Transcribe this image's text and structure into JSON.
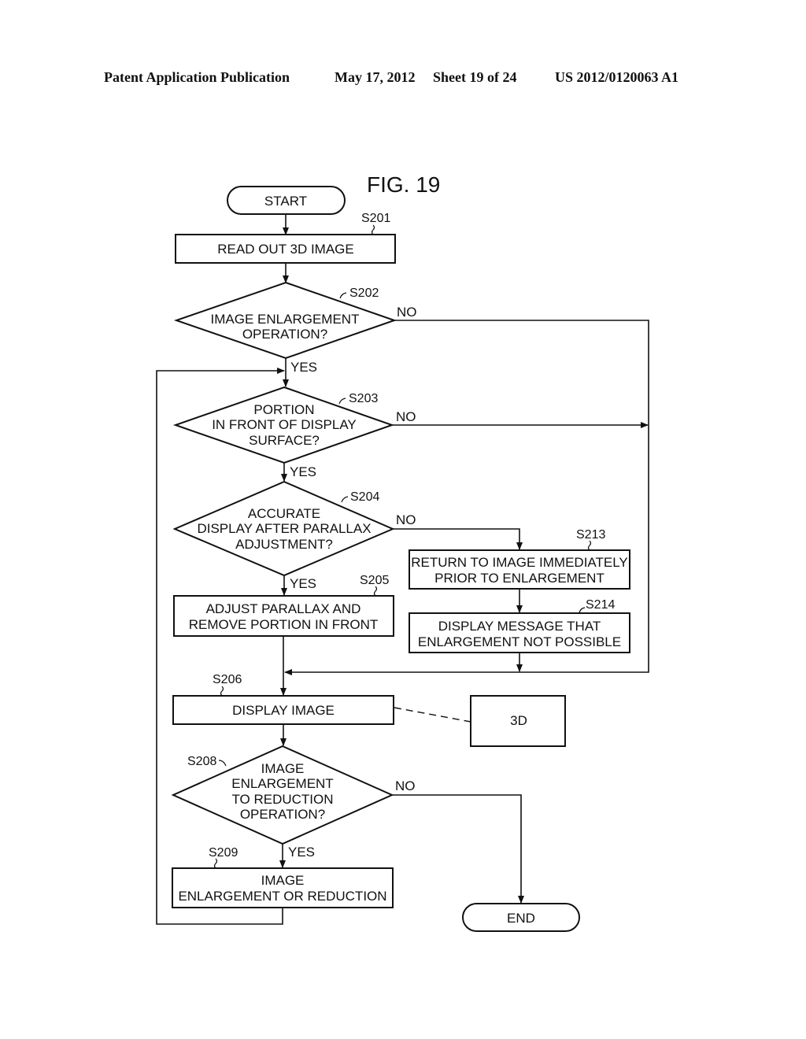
{
  "header": {
    "left": "Patent Application Publication",
    "date": "May 17, 2012",
    "sheet": "Sheet 19 of 24",
    "number": "US 2012/0120063 A1"
  },
  "figure": {
    "title": "FIG. 19",
    "terminals": {
      "start": "START",
      "end": "END"
    },
    "steps": {
      "s201": {
        "id": "S201",
        "lines": [
          "READ OUT 3D IMAGE"
        ]
      },
      "s202": {
        "id": "S202",
        "lines": [
          "IMAGE ENLARGEMENT",
          "OPERATION?"
        ]
      },
      "s203": {
        "id": "S203",
        "lines": [
          "PORTION",
          "IN FRONT OF DISPLAY",
          "SURFACE?"
        ]
      },
      "s204": {
        "id": "S204",
        "lines": [
          "ACCURATE",
          "DISPLAY AFTER PARALLAX",
          "ADJUSTMENT?"
        ]
      },
      "s205": {
        "id": "S205",
        "lines": [
          "ADJUST PARALLAX AND",
          "REMOVE PORTION IN FRONT"
        ]
      },
      "s206": {
        "id": "S206",
        "lines": [
          "DISPLAY IMAGE"
        ]
      },
      "s208": {
        "id": "S208",
        "lines": [
          "IMAGE",
          "ENLARGEMENT",
          "TO REDUCTION",
          "OPERATION?"
        ]
      },
      "s209": {
        "id": "S209",
        "lines": [
          "IMAGE",
          "ENLARGEMENT OR REDUCTION"
        ]
      },
      "s213": {
        "id": "S213",
        "lines": [
          "RETURN TO IMAGE IMMEDIATELY",
          "PRIOR TO ENLARGEMENT"
        ]
      },
      "s214": {
        "id": "S214",
        "lines": [
          "DISPLAY MESSAGE THAT",
          "ENLARGEMENT NOT POSSIBLE"
        ]
      }
    },
    "display_mode_box": "3D",
    "branch_labels": {
      "yes": "YES",
      "no": "NO"
    }
  }
}
